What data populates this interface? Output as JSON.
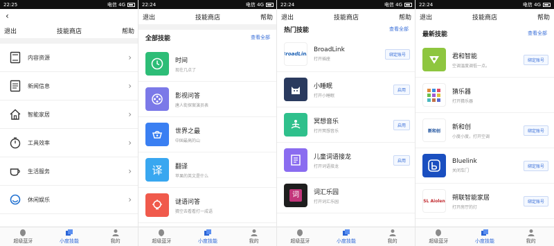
{
  "panels": [
    {
      "status_time": "22:25",
      "status_right": "电信 4G",
      "header": {
        "back": "退出",
        "title": "技能商店",
        "help": "帮助"
      },
      "menu": [
        {
          "label": "内容资源",
          "icon": "book-icon"
        },
        {
          "label": "新闻信息",
          "icon": "news-icon"
        },
        {
          "label": "智能家居",
          "icon": "home-icon"
        },
        {
          "label": "工具效率",
          "icon": "timer-icon"
        },
        {
          "label": "生活服务",
          "icon": "cup-icon"
        },
        {
          "label": "休闲娱乐",
          "icon": "game-icon"
        }
      ]
    },
    {
      "status_time": "22:24",
      "status_right": "电信 4G",
      "header": {
        "back": "退出",
        "title": "技能商店",
        "help": "帮助"
      },
      "section": {
        "title": "全部技能",
        "more": "查看全部"
      },
      "apps": [
        {
          "name": "时间",
          "desc": "现在几点了"
        },
        {
          "name": "影视问答",
          "desc": "唐人街探案演员表"
        },
        {
          "name": "世界之最",
          "desc": "中国最高的山"
        },
        {
          "name": "翻译",
          "desc": "苹果的英文是什么"
        },
        {
          "name": "谜语问答",
          "desc": "猜空去看看打一成语"
        }
      ]
    },
    {
      "status_time": "22:24",
      "status_right": "电信 4G",
      "header": {
        "back": "退出",
        "title": "技能商店",
        "help": "帮助"
      },
      "section": {
        "title": "热门技能",
        "more": "查看全部"
      },
      "apps": [
        {
          "name": "BroadLink",
          "desc": "打开插座",
          "button": "绑定账号"
        },
        {
          "name": "小睡眠",
          "desc": "打开小睡眠",
          "button": "启用"
        },
        {
          "name": "冥想音乐",
          "desc": "打开冥想音乐",
          "button": "启用"
        },
        {
          "name": "儿童词语接龙",
          "desc": "打开词语接龙",
          "button": "启用"
        },
        {
          "name": "词汇乐园",
          "desc": "打开词汇乐园",
          "button": "启用"
        }
      ]
    },
    {
      "status_time": "22:24",
      "status_right": "电信 4G",
      "header": {
        "back": "退出",
        "title": "技能商店",
        "help": "帮助"
      },
      "section": {
        "title": "最新技能",
        "more": "查看全部"
      },
      "apps": [
        {
          "name": "君和智能",
          "desc": "空调温度调低一点。",
          "button": "绑定账号"
        },
        {
          "name": "猜乐器",
          "desc": "打开猜乐器"
        },
        {
          "name": "新和创",
          "desc": "小度小度，打开空调",
          "button": "绑定账号"
        },
        {
          "name": "Bluelink",
          "desc": "关闭车门",
          "button": "绑定账号"
        },
        {
          "name": "朔联智能家居",
          "desc": "打开房厅的灯",
          "button": "绑定账号"
        }
      ]
    }
  ],
  "tabs": [
    {
      "label": "超级蓝牙",
      "icon": "bluetooth-icon"
    },
    {
      "label": "小度技能",
      "icon": "skills-icon"
    },
    {
      "label": "我的",
      "icon": "profile-icon"
    }
  ],
  "logos": {
    "broadlink": "BroadLink",
    "ci": "词",
    "xin": "新和创",
    "sl": "SL Aiolen"
  },
  "colors": {
    "accent": "#2a64d6",
    "time": "#2dbd77",
    "movie": "#7b79e8",
    "world": "#3a7ff2",
    "translate": "#39a7f0",
    "riddle": "#f05a4c",
    "sleep": "#2a3a5e",
    "meditation": "#2fc08c",
    "words": "#8a6cf0",
    "junhe": "#8ec63f"
  }
}
